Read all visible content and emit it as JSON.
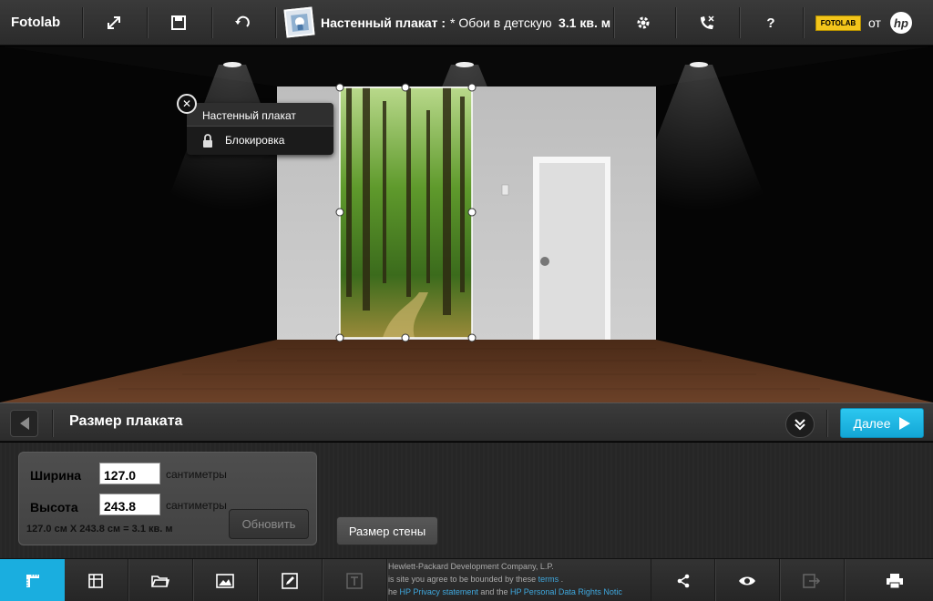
{
  "header": {
    "brand": "Fotolab",
    "product_title": "Настенный плакат :",
    "project_name": "* Обои в детскую",
    "area": "3.1 кв. м",
    "fotolab_badge": "FOTOLAB",
    "from_label": "от",
    "hp_logo": "hp",
    "icons": [
      "expand-icon",
      "save-icon",
      "undo-icon",
      "settings-icon",
      "phone-support-icon",
      "help-icon"
    ]
  },
  "context_menu": {
    "title": "Настенный плакат",
    "lock_label": "Блокировка",
    "close_symbol": "✕"
  },
  "strip": {
    "title": "Размер плаката",
    "next_label": "Далее"
  },
  "size_panel": {
    "width_label": "Ширина",
    "width_value": "127.0",
    "width_unit": "сантиметры",
    "height_label": "Высота",
    "height_value": "243.8",
    "height_unit": "сантиметры",
    "calc": "127.0 см X 243.8 см = 3.1 кв. м",
    "update_label": "Обновить",
    "wall_size_label": "Размер стены"
  },
  "legal": {
    "line1": "Hewlett-Packard Development Company, L.P.",
    "line2_pre": "is site you agree to be bounded by these",
    "line2_link": "terms",
    "line2_post": ".",
    "line3_pre": "he",
    "line3_link1": "HP Privacy statement",
    "line3_mid": "and the",
    "line3_link2": "HP Personal Data Rights Notic"
  },
  "toolbar_icons": [
    "size-ruler-icon",
    "layout-grid-icon",
    "folder-icon",
    "image-icon",
    "edit-icon",
    "text-icon",
    "share-icon",
    "preview-eye-icon",
    "export-icon",
    "print-icon"
  ],
  "colors": {
    "accent": "#1aaedf",
    "wall": "#c4c4c4",
    "floor": "#5b3520"
  }
}
